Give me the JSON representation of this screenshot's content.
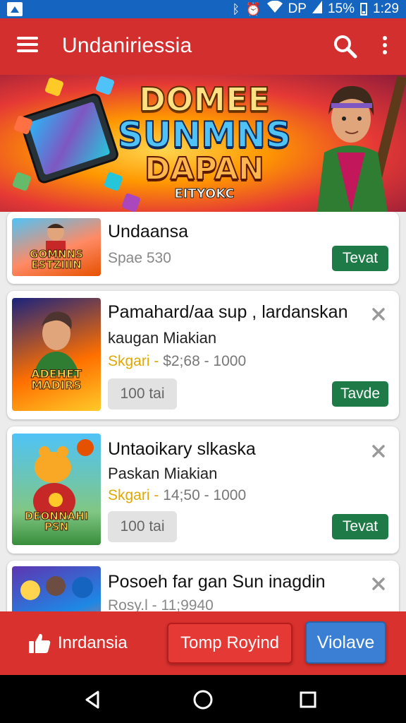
{
  "status_bar": {
    "right_text": "DP",
    "battery": "15%",
    "time": "1:29",
    "icons": [
      "notification-icon",
      "bluetooth-icon",
      "alarm-icon",
      "wifi-icon",
      "signal-icon",
      "battery-icon"
    ]
  },
  "app_bar": {
    "title": "Undaniriessia",
    "color": "#d32f2f"
  },
  "banner": {
    "line1": "DOMEE",
    "line2": "SUNMNS",
    "line3": "DAPAN",
    "line4": "EITYOKC"
  },
  "items": [
    {
      "thumb_caption": "GOMNNS ESTZIIIN",
      "title": "Undaansa",
      "meta": "Spae 530",
      "button": "Tevat"
    },
    {
      "thumb_caption": "ADEHET MADIRS",
      "title": "Pamahard/aa sup , lardanskan",
      "subtitle": "kaugan Miakian",
      "price_highlight": "Skgari -",
      "price_rest": " $2;68 - 1000",
      "pill": "100 tai",
      "button": "Tavde"
    },
    {
      "thumb_caption": "DEONNAHI PSN",
      "title": "Untaoikary slkaska",
      "subtitle": "Paskan Miakian",
      "price_highlight": "Skgari -",
      "price_rest": " 14;50 - 1000",
      "pill": "100 tai",
      "button": "Tevat"
    },
    {
      "title": "Posoeh far gan Sun inagdin",
      "meta": "Rosy.l - 11;9940"
    }
  ],
  "action_bar": {
    "like_label": "Inrdansia",
    "primary": "Tomp Royind",
    "secondary": "Violave",
    "colors": {
      "bar": "#d9312e",
      "primary": "#e53935",
      "secondary": "#3b7fd4",
      "green": "#1e7a46"
    }
  }
}
